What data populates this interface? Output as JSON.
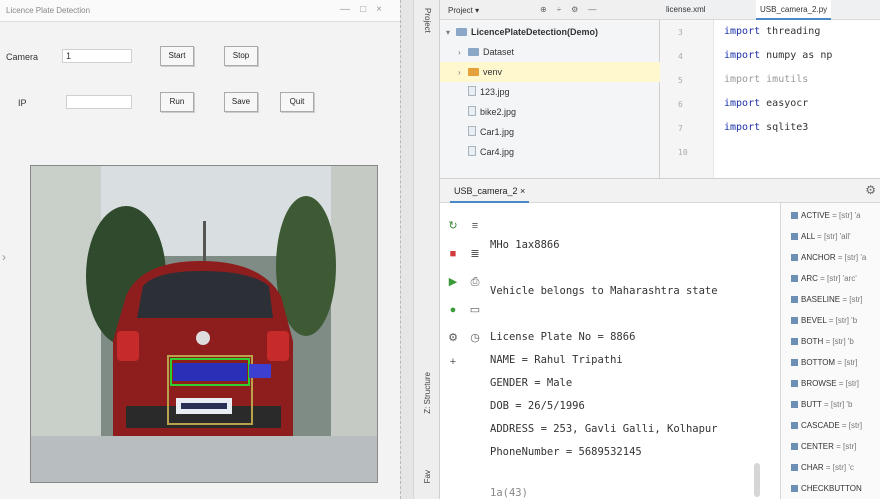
{
  "left_app": {
    "title": "Licence Plate Detection",
    "row1_label": "Camera",
    "row1_value": "1",
    "row2_label": "IP",
    "row2_value": "",
    "buttons": {
      "start": "Start",
      "stop": "Stop",
      "b3": "Run",
      "b4": "Save",
      "b5": "Quit"
    }
  },
  "ide": {
    "side_tabs": {
      "project": "Project",
      "structure": "Z: Structure",
      "favorites": "Fav"
    },
    "project_panel": {
      "dropdown": "Project ▾",
      "root": "LicencePlateDetection(Demo)",
      "items": [
        {
          "name": "Dataset",
          "kind": "folder"
        },
        {
          "name": "venv",
          "kind": "folder"
        },
        {
          "name": "123.jpg",
          "kind": "file"
        },
        {
          "name": "bike2.jpg",
          "kind": "file"
        },
        {
          "name": "Car1.jpg",
          "kind": "file"
        },
        {
          "name": "Car4.jpg",
          "kind": "file"
        }
      ]
    },
    "editor": {
      "tabs": [
        "license.xml",
        "USB_camera_2.py"
      ],
      "lines": [
        {
          "num": "3",
          "kw": "import",
          "mod": "threading"
        },
        {
          "num": "4",
          "kw": "import",
          "mod": "numpy as np"
        },
        {
          "num": "5",
          "kw": "import",
          "mod": "imutils"
        },
        {
          "num": "6",
          "kw": "import",
          "mod": "easyocr"
        },
        {
          "num": "7",
          "kw": "import",
          "mod": "sqlite3"
        },
        {
          "num": "10",
          "kw": "",
          "mod": ""
        }
      ]
    },
    "run_panel": {
      "tab_label": "USB_camera_2",
      "console": {
        "l1": "MHo 1ax8866",
        "l2": "Vehicle belongs to Maharashtra state",
        "l3": "License Plate No =  8866",
        "l4": "NAME =  Rahul Tripathi",
        "l5": "GENDER =  Male",
        "l6": "DOB =  26/5/1996",
        "l7": "ADDRESS =  253, Gavli Galli, Kolhapur",
        "l8": "PhoneNumber =  5689532145",
        "l9": "1a(43)"
      }
    },
    "structure_items": [
      {
        "name": "ACTIVE",
        "val": " = [str] 'a"
      },
      {
        "name": "ALL",
        "val": " = [str] 'all'"
      },
      {
        "name": "ANCHOR",
        "val": " = [str] 'a"
      },
      {
        "name": "ARC",
        "val": " = [str] 'arc'"
      },
      {
        "name": "BASELINE",
        "val": " = [str]"
      },
      {
        "name": "BEVEL",
        "val": " = [str] 'b"
      },
      {
        "name": "BOTH",
        "val": " = [str] 'b"
      },
      {
        "name": "BOTTOM",
        "val": " = [str]"
      },
      {
        "name": "BROWSE",
        "val": " = [str]"
      },
      {
        "name": "BUTT",
        "val": " = [str] 'b"
      },
      {
        "name": "CASCADE",
        "val": " = [str]"
      },
      {
        "name": "CENTER",
        "val": " = [str]"
      },
      {
        "name": "CHAR",
        "val": " = [str] 'c"
      },
      {
        "name": "CHECKBUTTON",
        "val": ""
      }
    ]
  },
  "colors": {
    "accent": "#4a88c7",
    "folder_blue": "#8aa7c8",
    "folder_orange": "#e5a23a",
    "selection": "#fff8cf"
  }
}
